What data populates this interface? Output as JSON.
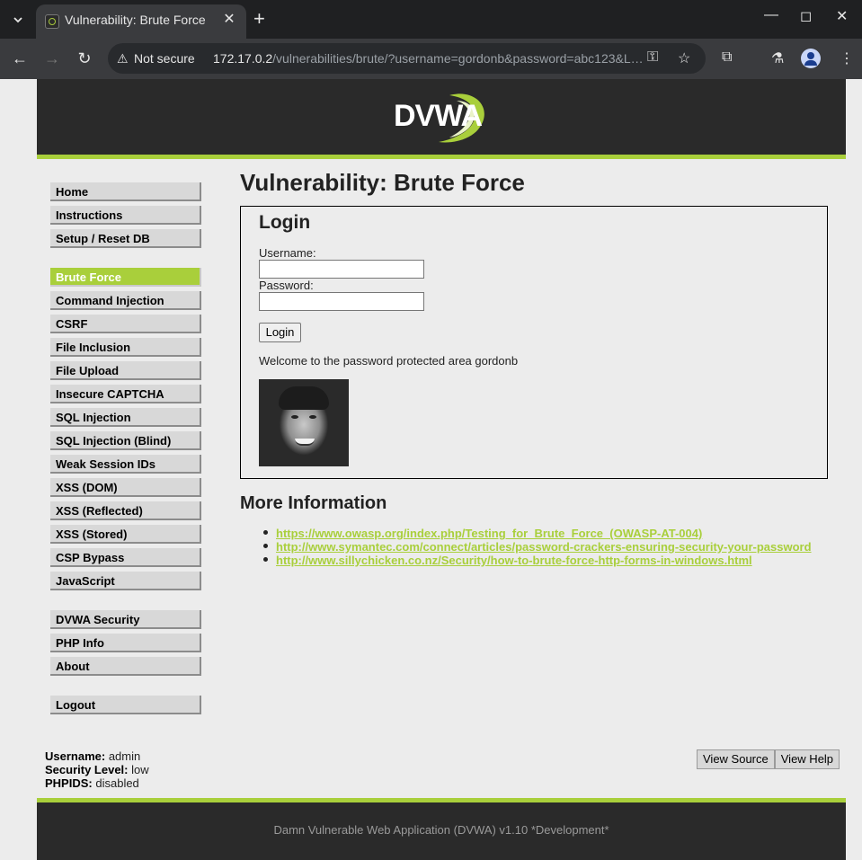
{
  "browser": {
    "tab_title": "Vulnerability: Brute Force",
    "security_label": "Not secure",
    "url_host": "172.17.0.2",
    "url_path": "/vulnerabilities/brute/?username=gordonb&password=abc123&L…",
    "icons": {
      "tab_list": "chevron-down-icon",
      "new_tab": "plus-icon",
      "minimize": "minimize-icon",
      "maximize": "maximize-icon",
      "close": "close-icon",
      "back": "arrow-left-icon",
      "forward": "arrow-right-icon",
      "reload": "reload-icon",
      "warning": "warning-icon",
      "key": "key-icon",
      "bookmark": "star-icon",
      "extensions": "puzzle-icon",
      "labs": "flask-icon",
      "profile": "avatar-icon",
      "menu": "kebab-menu-icon"
    }
  },
  "header": {
    "logo_text": "DVWA"
  },
  "sidebar": {
    "items": [
      {
        "label": "Home"
      },
      {
        "label": "Instructions"
      },
      {
        "label": "Setup / Reset DB"
      },
      {
        "label": "Brute Force",
        "active": true
      },
      {
        "label": "Command Injection"
      },
      {
        "label": "CSRF"
      },
      {
        "label": "File Inclusion"
      },
      {
        "label": "File Upload"
      },
      {
        "label": "Insecure CAPTCHA"
      },
      {
        "label": "SQL Injection"
      },
      {
        "label": "SQL Injection (Blind)"
      },
      {
        "label": "Weak Session IDs"
      },
      {
        "label": "XSS (DOM)"
      },
      {
        "label": "XSS (Reflected)"
      },
      {
        "label": "XSS (Stored)"
      },
      {
        "label": "CSP Bypass"
      },
      {
        "label": "JavaScript"
      },
      {
        "label": "DVWA Security"
      },
      {
        "label": "PHP Info"
      },
      {
        "label": "About"
      },
      {
        "label": "Logout"
      }
    ]
  },
  "main": {
    "page_title": "Vulnerability: Brute Force",
    "login": {
      "heading": "Login",
      "username_label": "Username:",
      "username_value": "",
      "password_label": "Password:",
      "password_value": "",
      "submit_label": "Login",
      "welcome_text": "Welcome to the password protected area gordonb"
    },
    "more_info": {
      "heading": "More Information",
      "links": [
        "https://www.owasp.org/index.php/Testing_for_Brute_Force_(OWASP-AT-004)",
        "http://www.symantec.com/connect/articles/password-crackers-ensuring-security-your-password",
        "http://www.sillychicken.co.nz/Security/how-to-brute-force-http-forms-in-windows.html"
      ]
    }
  },
  "status": {
    "username_label": "Username:",
    "username_value": "admin",
    "security_label": "Security Level:",
    "security_value": "low",
    "phpids_label": "PHPIDS:",
    "phpids_value": "disabled"
  },
  "buttons": {
    "view_source": "View Source",
    "view_help": "View Help"
  },
  "footer": {
    "text": "Damn Vulnerable Web Application (DVWA) v1.10 *Development*"
  },
  "colors": {
    "accent": "#a9cf3b",
    "header_bg": "#2a2a2a",
    "page_bg": "#ececec"
  }
}
